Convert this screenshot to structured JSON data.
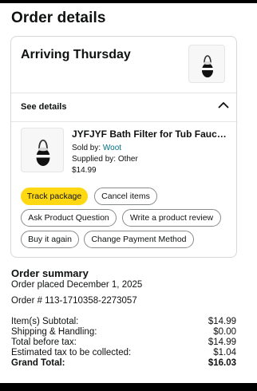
{
  "page": {
    "title": "Order details"
  },
  "delivery": {
    "arriving": "Arriving Thursday"
  },
  "details": {
    "label": "See details"
  },
  "product": {
    "title": "JYFJYF Bath Filter for Tub Faucet...",
    "sold_by_prefix": "Sold by: ",
    "seller": "Woot",
    "supplied_by": "Supplied by: Other",
    "price": "$14.99"
  },
  "actions": {
    "track": "Track package",
    "cancel": "Cancel items",
    "ask": "Ask Product Question",
    "review": "Write a product review",
    "buy_again": "Buy it again",
    "change_payment": "Change Payment Method"
  },
  "summary": {
    "title": "Order summary",
    "placed": "Order placed December 1, 2025",
    "order_number": "Order # 113-1710358-2273057",
    "rows": [
      {
        "label": "Item(s) Subtotal:",
        "value": "$14.99"
      },
      {
        "label": "Shipping & Handling:",
        "value": "$0.00"
      },
      {
        "label": "Total before tax:",
        "value": "$14.99"
      },
      {
        "label": "Estimated tax to be collected:",
        "value": "$1.04"
      },
      {
        "label": "Grand Total:",
        "value": "$16.03"
      }
    ]
  },
  "icons": {
    "collapse": "chevron-up-icon",
    "product_image": "bath-filter-icon"
  },
  "colors": {
    "accent_yellow": "#ffd814",
    "link": "#007185",
    "border": "#d5d9d9"
  }
}
